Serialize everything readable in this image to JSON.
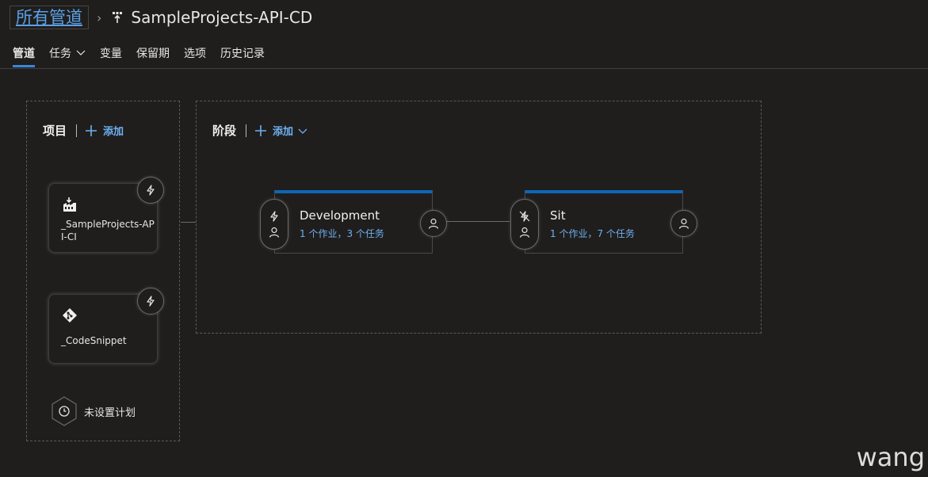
{
  "breadcrumb": {
    "root": "所有管道",
    "separator": "›",
    "title": "SampleProjects-API-CD"
  },
  "tabs": [
    {
      "label": "管道",
      "active": true
    },
    {
      "label": "任务",
      "has_dropdown": true
    },
    {
      "label": "变量"
    },
    {
      "label": "保留期"
    },
    {
      "label": "选项"
    },
    {
      "label": "历史记录"
    }
  ],
  "artifacts_panel": {
    "title": "项目",
    "add_label": "添加",
    "items": [
      {
        "name": "_SampleProjects-API-CI",
        "icon": "build-icon"
      },
      {
        "name": "_CodeSnippet",
        "icon": "git-icon"
      }
    ],
    "schedule_label": "未设置计划"
  },
  "stages_panel": {
    "title": "阶段",
    "add_label": "添加",
    "stages": [
      {
        "name": "Development",
        "summary": "1 个作业，3 个任务"
      },
      {
        "name": "Sit",
        "summary": "1 个作业，7 个任务"
      }
    ]
  },
  "watermark": "wang",
  "colors": {
    "background": "#1f1e1d",
    "accent": "#0f66b5",
    "link": "#6fb0f0"
  }
}
